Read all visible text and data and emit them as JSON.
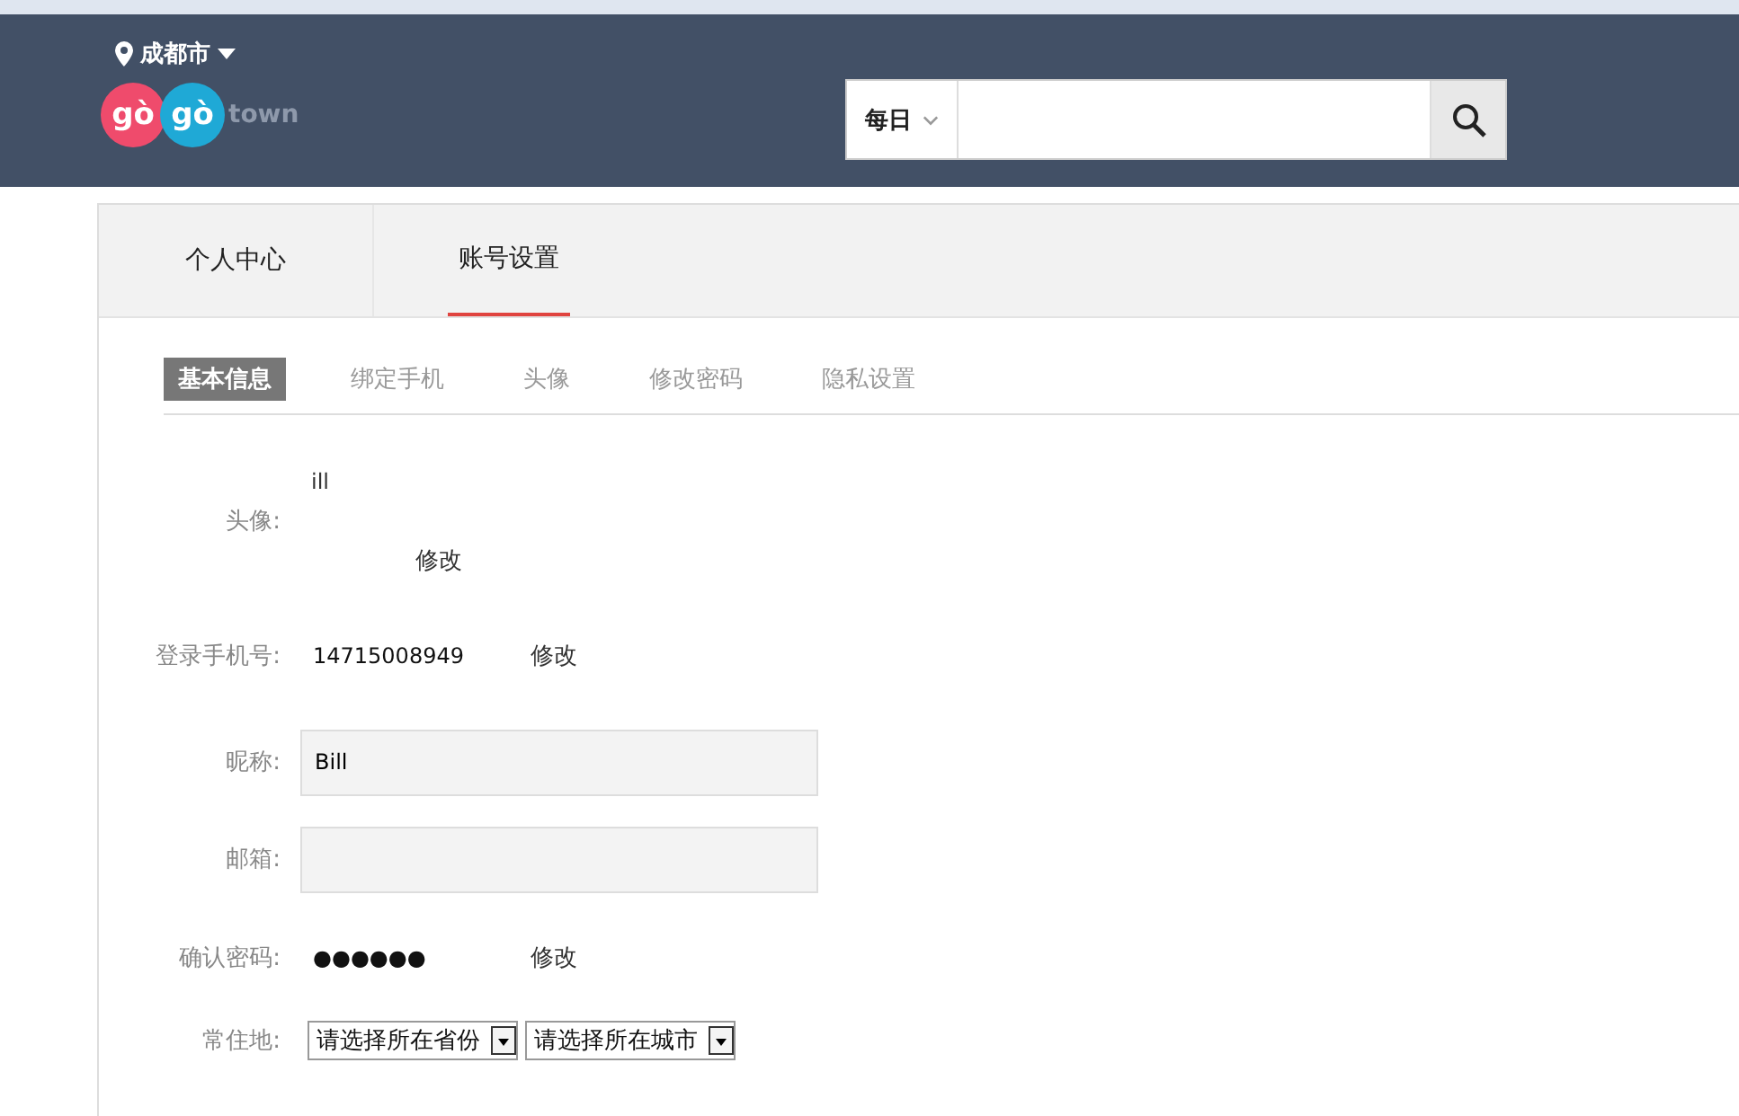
{
  "header": {
    "city": "成都市",
    "logo": {
      "left": "gò",
      "right": "gò",
      "suffix": "town"
    },
    "search": {
      "scope": "每日"
    }
  },
  "main_tabs": [
    {
      "label": "个人中心",
      "selected": false
    },
    {
      "label": "账号设置",
      "selected": true
    }
  ],
  "sub_tabs": [
    {
      "label": "基本信息",
      "selected": true
    },
    {
      "label": "绑定手机",
      "selected": false
    },
    {
      "label": "头像",
      "selected": false
    },
    {
      "label": "修改密码",
      "selected": false
    },
    {
      "label": "隐私设置",
      "selected": false
    }
  ],
  "form": [
    {
      "kind": "avatar",
      "label": "头像:",
      "alt": "ill",
      "action": "修改"
    },
    {
      "kind": "text",
      "label": "登录手机号:",
      "value": "14715008949",
      "action": "修改"
    },
    {
      "kind": "input",
      "label": "昵称:",
      "value": "Bill"
    },
    {
      "kind": "input",
      "label": "邮箱:"
    },
    {
      "kind": "text",
      "label": "确认密码:",
      "value": "●●●●●●",
      "action": "修改"
    },
    {
      "kind": "selects",
      "label": "常住地:",
      "options": [
        "请选择所在省份",
        "请选择所在城市"
      ]
    }
  ]
}
